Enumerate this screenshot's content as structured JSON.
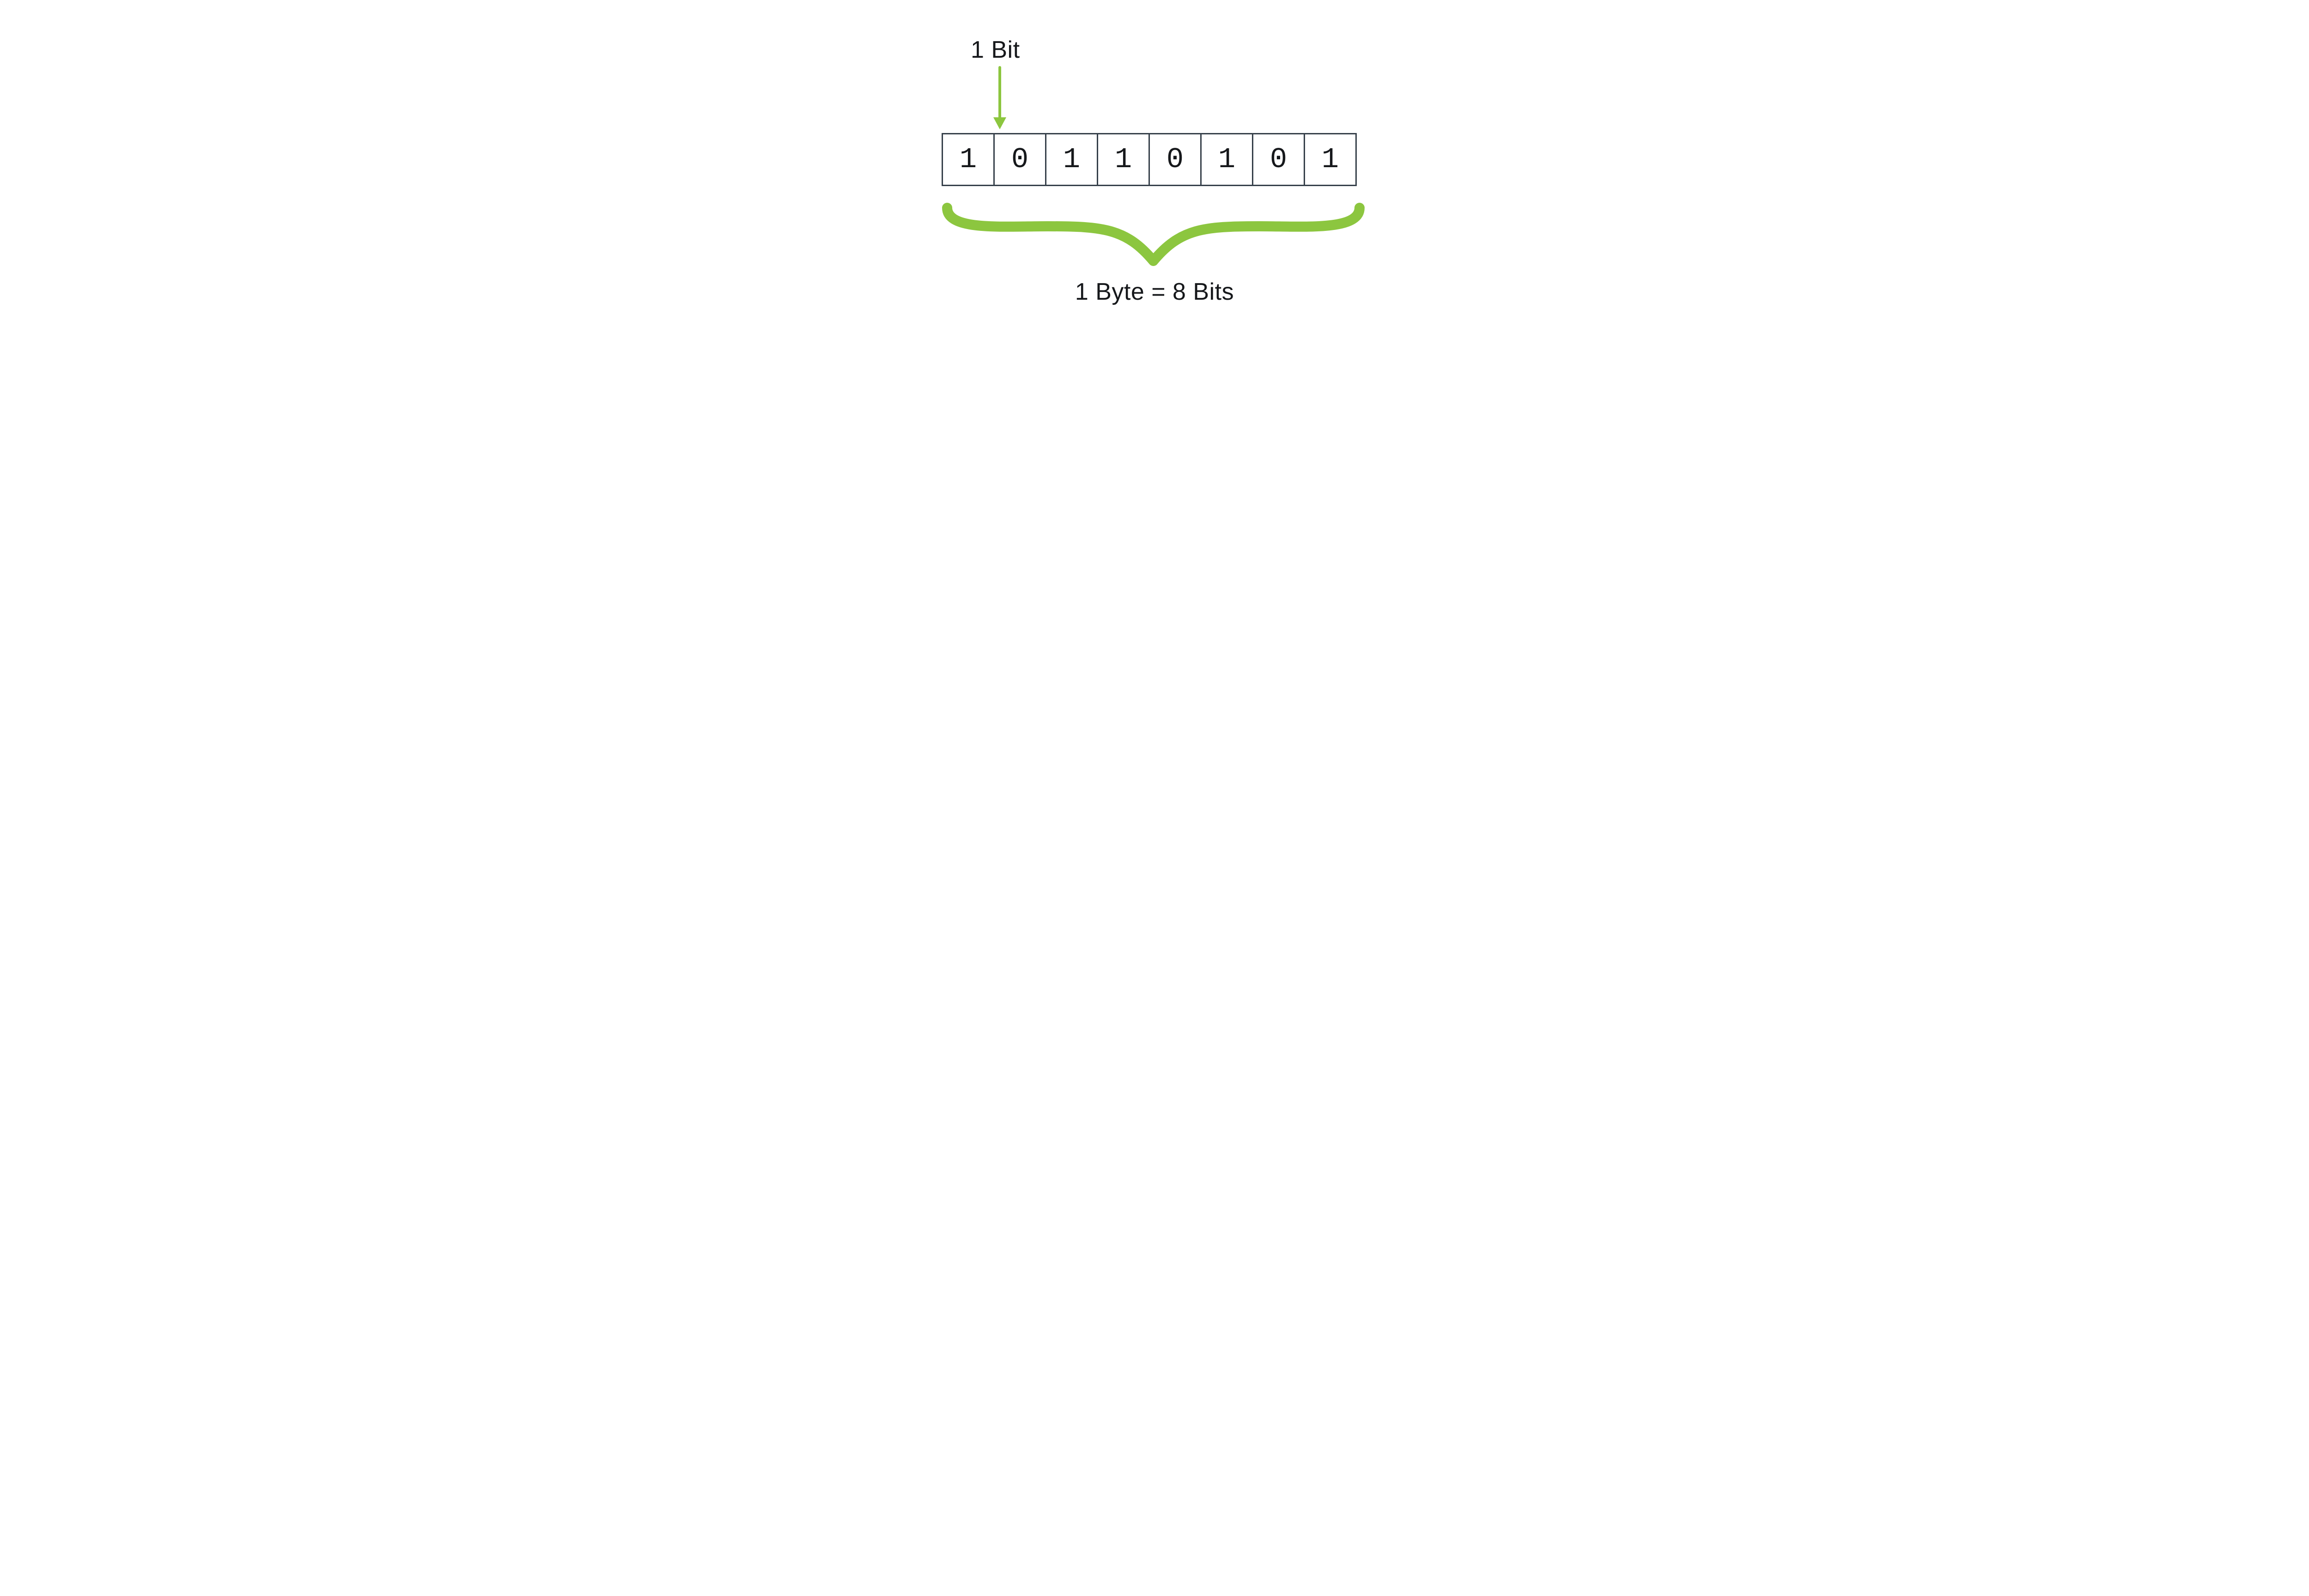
{
  "labels": {
    "bit": "1 Bit",
    "byte": "1 Byte = 8 Bits"
  },
  "bits": [
    "1",
    "0",
    "1",
    "1",
    "0",
    "1",
    "0",
    "1"
  ],
  "colors": {
    "accent": "#8CC63F",
    "cellBorder": "#36404a",
    "text": "#16181b"
  }
}
